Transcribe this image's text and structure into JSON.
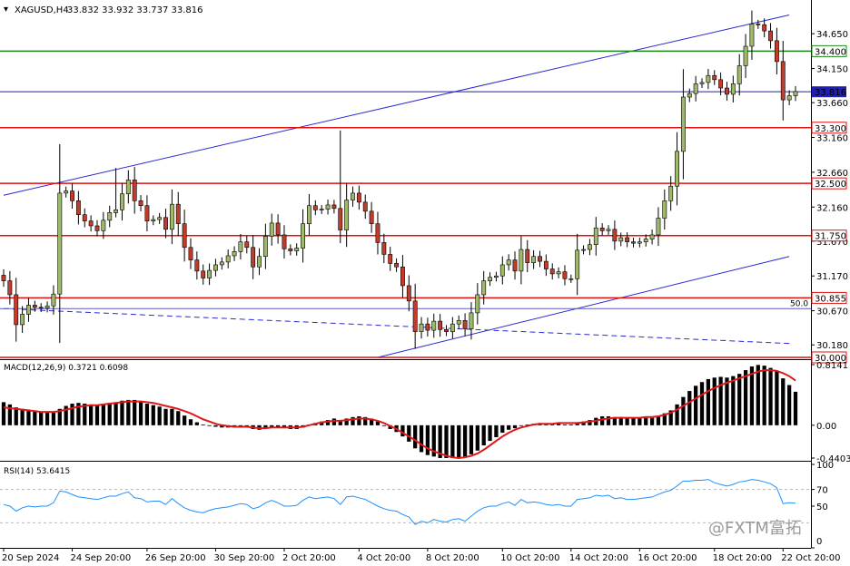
{
  "header": {
    "symbol_label": "XAGUSD,H4",
    "ohlc_label": "33.832 33.932 33.737 33.816"
  },
  "watermark": "@FXTM富拓",
  "chart_data": [
    {
      "type": "candlestick",
      "title": "XAGUSD,H4",
      "ylim": [
        30.0,
        34.9
      ],
      "y_ticks": [
        "34.650",
        "34.150",
        "33.660",
        "33.160",
        "32.660",
        "32.160",
        "31.670",
        "31.170",
        "30.670",
        "30.180"
      ],
      "x_tick_labels": [
        "20 Sep 2024",
        "24 Sep 20:00",
        "26 Sep 20:00",
        "30 Sep 20:00",
        "2 Oct 20:00",
        "4 Oct 20:00",
        "8 Oct 20:00",
        "10 Oct 20:00",
        "14 Oct 20:00",
        "16 Oct 20:00",
        "18 Oct 20:00",
        "22 Oct 20:00"
      ],
      "last_price": 33.816,
      "horizontal_levels": [
        {
          "label": "34.400",
          "value": 34.4,
          "color": "#1a8c1a"
        },
        {
          "label": "33.816",
          "value": 33.816,
          "color": "#1f1fb4"
        },
        {
          "label": "33.300",
          "value": 33.3,
          "color": "#e01010"
        },
        {
          "label": "32.500",
          "value": 32.5,
          "color": "#e01010"
        },
        {
          "label": "31.750",
          "value": 31.75,
          "color": "#e01010"
        },
        {
          "label": "30.855",
          "value": 30.855,
          "color": "#e01010"
        },
        {
          "label": "30.000",
          "value": 30.0,
          "color": "#e01010"
        }
      ],
      "fib_label": "50.0",
      "fib_value": 30.7,
      "trend_channel": [
        {
          "from": [
            0,
            32.33
          ],
          "to": [
            126,
            34.92
          ]
        },
        {
          "from": [
            60,
            30.0
          ],
          "to": [
            126,
            31.45
          ]
        },
        {
          "from": [
            0,
            30.7
          ],
          "to": [
            126,
            30.2
          ],
          "dashed": true
        }
      ],
      "up_color": "#9fb96a",
      "down_color": "#c23b2b",
      "candles_close": [
        31.1,
        30.9,
        30.47,
        30.62,
        30.75,
        30.72,
        30.71,
        30.74,
        30.91,
        32.36,
        32.39,
        32.25,
        32.05,
        31.96,
        31.89,
        31.82,
        31.97,
        32.08,
        32.12,
        32.35,
        32.55,
        32.25,
        32.18,
        31.96,
        31.98,
        32.01,
        31.84,
        32.2,
        31.92,
        31.58,
        31.4,
        31.24,
        31.14,
        31.25,
        31.33,
        31.37,
        31.46,
        31.52,
        31.66,
        31.58,
        31.3,
        31.45,
        31.74,
        31.93,
        31.76,
        31.56,
        31.53,
        31.57,
        31.92,
        32.18,
        32.12,
        32.13,
        32.19,
        32.14,
        31.83,
        32.26,
        32.36,
        32.23,
        32.1,
        31.92,
        31.65,
        31.48,
        31.35,
        31.3,
        31.03,
        30.81,
        30.37,
        30.48,
        30.39,
        30.52,
        30.4,
        30.37,
        30.48,
        30.53,
        30.41,
        30.64,
        30.9,
        31.1,
        31.15,
        31.17,
        31.33,
        31.4,
        31.24,
        31.55,
        31.36,
        31.45,
        31.38,
        31.27,
        31.2,
        31.23,
        31.13,
        31.13,
        31.54,
        31.55,
        31.62,
        31.86,
        31.82,
        31.84,
        31.67,
        31.72,
        31.66,
        31.64,
        31.66,
        31.7,
        31.76,
        32.0,
        32.25,
        32.46,
        32.96,
        33.74,
        33.79,
        33.93,
        33.95,
        34.05,
        33.99,
        33.87,
        33.78,
        33.93,
        34.19,
        34.47,
        34.79,
        34.78,
        34.69,
        34.55,
        34.25,
        33.7,
        33.76,
        33.82
      ],
      "macd": {
        "label": "MACD(12,26,9) 0.3721 0.6098",
        "ylim": [
          -0.4403,
          0.8141
        ],
        "y_ticks": [
          "0.8141",
          "0.00",
          "-0.4403"
        ],
        "histogram": [
          0.31,
          0.28,
          0.24,
          0.22,
          0.2,
          0.19,
          0.18,
          0.17,
          0.17,
          0.22,
          0.26,
          0.29,
          0.3,
          0.29,
          0.28,
          0.27,
          0.28,
          0.3,
          0.31,
          0.33,
          0.34,
          0.34,
          0.32,
          0.29,
          0.27,
          0.25,
          0.22,
          0.22,
          0.19,
          0.13,
          0.08,
          0.04,
          0.01,
          -0.01,
          -0.02,
          -0.03,
          -0.03,
          -0.02,
          -0.01,
          -0.02,
          -0.05,
          -0.06,
          -0.05,
          -0.02,
          -0.02,
          -0.04,
          -0.05,
          -0.05,
          -0.03,
          0.01,
          0.03,
          0.05,
          0.07,
          0.09,
          0.07,
          0.09,
          0.11,
          0.12,
          0.11,
          0.09,
          0.05,
          0.0,
          -0.05,
          -0.09,
          -0.15,
          -0.22,
          -0.31,
          -0.36,
          -0.4,
          -0.42,
          -0.44,
          -0.44,
          -0.44,
          -0.43,
          -0.42,
          -0.39,
          -0.34,
          -0.27,
          -0.21,
          -0.16,
          -0.1,
          -0.06,
          -0.04,
          0.0,
          0.01,
          0.02,
          0.03,
          0.02,
          0.01,
          0.02,
          0.01,
          0.01,
          0.04,
          0.05,
          0.07,
          0.1,
          0.12,
          0.12,
          0.11,
          0.11,
          0.1,
          0.1,
          0.1,
          0.1,
          0.1,
          0.12,
          0.16,
          0.2,
          0.28,
          0.38,
          0.46,
          0.53,
          0.58,
          0.62,
          0.64,
          0.65,
          0.64,
          0.66,
          0.69,
          0.74,
          0.79,
          0.81,
          0.8,
          0.77,
          0.73,
          0.63,
          0.54,
          0.45
        ],
        "signal": [
          0.24,
          0.23,
          0.22,
          0.21,
          0.2,
          0.19,
          0.18,
          0.18,
          0.18,
          0.19,
          0.21,
          0.23,
          0.25,
          0.26,
          0.27,
          0.27,
          0.28,
          0.29,
          0.3,
          0.31,
          0.32,
          0.32,
          0.32,
          0.31,
          0.3,
          0.28,
          0.26,
          0.24,
          0.22,
          0.19,
          0.16,
          0.12,
          0.08,
          0.05,
          0.02,
          0.0,
          -0.01,
          -0.02,
          -0.02,
          -0.02,
          -0.03,
          -0.04,
          -0.04,
          -0.03,
          -0.03,
          -0.03,
          -0.03,
          -0.03,
          -0.02,
          0.0,
          0.02,
          0.04,
          0.05,
          0.06,
          0.06,
          0.07,
          0.08,
          0.09,
          0.09,
          0.08,
          0.06,
          0.03,
          -0.01,
          -0.05,
          -0.1,
          -0.15,
          -0.2,
          -0.26,
          -0.31,
          -0.35,
          -0.38,
          -0.41,
          -0.43,
          -0.44,
          -0.43,
          -0.41,
          -0.38,
          -0.33,
          -0.27,
          -0.21,
          -0.15,
          -0.1,
          -0.06,
          -0.03,
          -0.01,
          0.01,
          0.02,
          0.02,
          0.02,
          0.03,
          0.03,
          0.03,
          0.03,
          0.04,
          0.05,
          0.06,
          0.08,
          0.09,
          0.1,
          0.1,
          0.1,
          0.1,
          0.1,
          0.11,
          0.11,
          0.12,
          0.14,
          0.17,
          0.21,
          0.26,
          0.31,
          0.36,
          0.41,
          0.46,
          0.5,
          0.54,
          0.57,
          0.6,
          0.63,
          0.66,
          0.69,
          0.72,
          0.74,
          0.74,
          0.73,
          0.7,
          0.66,
          0.6
        ]
      },
      "rsi": {
        "label": "RSI(14) 53.6415",
        "ylim": [
          0,
          100
        ],
        "levels": [
          30,
          70
        ],
        "y_ticks": [
          "100",
          "70",
          "50",
          "0"
        ],
        "values": [
          52,
          50,
          44,
          48,
          50,
          49,
          50,
          50,
          54,
          68,
          67,
          64,
          61,
          60,
          59,
          58,
          60,
          62,
          62,
          65,
          67,
          60,
          59,
          55,
          56,
          56,
          52,
          59,
          53,
          48,
          45,
          43,
          42,
          45,
          47,
          48,
          49,
          51,
          53,
          52,
          47,
          49,
          54,
          57,
          54,
          50,
          50,
          51,
          57,
          61,
          59,
          60,
          61,
          59,
          52,
          61,
          62,
          60,
          58,
          54,
          50,
          47,
          45,
          44,
          40,
          37,
          28,
          32,
          30,
          34,
          32,
          31,
          34,
          35,
          32,
          38,
          44,
          48,
          50,
          50,
          53,
          55,
          51,
          58,
          54,
          55,
          54,
          52,
          51,
          52,
          50,
          50,
          58,
          59,
          60,
          63,
          62,
          63,
          59,
          60,
          58,
          58,
          59,
          60,
          61,
          64,
          67,
          69,
          74,
          80,
          80,
          81,
          81,
          82,
          78,
          76,
          74,
          76,
          79,
          80,
          82,
          81,
          79,
          77,
          72,
          53,
          54,
          53.64
        ]
      }
    }
  ]
}
